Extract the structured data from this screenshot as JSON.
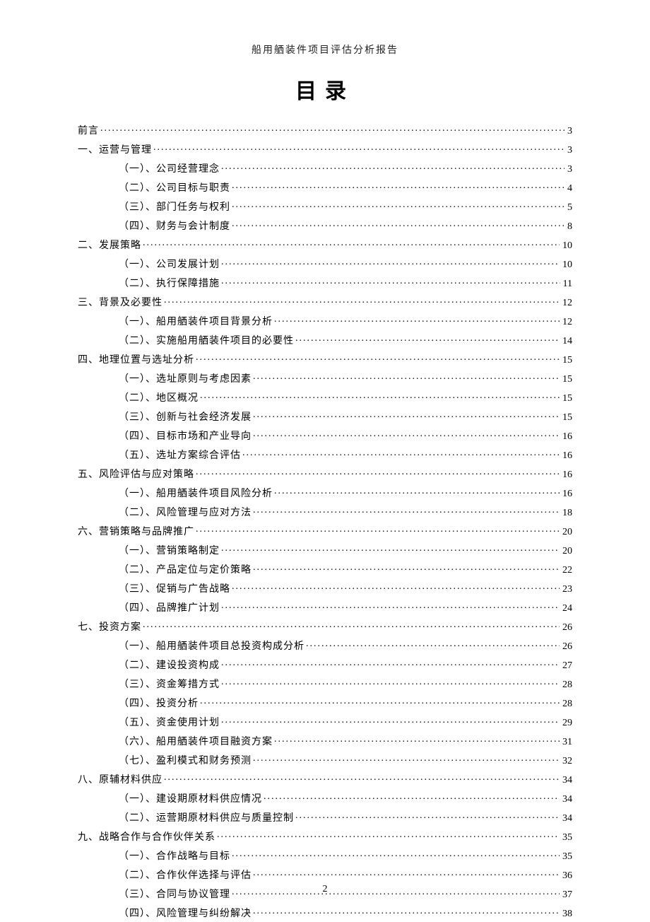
{
  "header": "船用舾装件项目评估分析报告",
  "title": "目录",
  "page_number": "2",
  "toc": [
    {
      "level": 0,
      "label": "前言",
      "page": "3"
    },
    {
      "level": 0,
      "label": "一、运营与管理",
      "page": "3"
    },
    {
      "level": 1,
      "label": "（一）、公司经营理念",
      "page": "3"
    },
    {
      "level": 1,
      "label": "（二）、公司目标与职责",
      "page": "4"
    },
    {
      "level": 1,
      "label": "（三）、部门任务与权利",
      "page": "5"
    },
    {
      "level": 1,
      "label": "（四）、财务与会计制度",
      "page": "8"
    },
    {
      "level": 0,
      "label": "二、发展策略",
      "page": "10"
    },
    {
      "level": 1,
      "label": "（一）、公司发展计划",
      "page": "10"
    },
    {
      "level": 1,
      "label": "（二）、执行保障措施",
      "page": "11"
    },
    {
      "level": 0,
      "label": "三、背景及必要性",
      "page": "12"
    },
    {
      "level": 1,
      "label": "（一）、船用舾装件项目背景分析",
      "page": "12"
    },
    {
      "level": 1,
      "label": "（二）、实施船用舾装件项目的必要性",
      "page": "14"
    },
    {
      "level": 0,
      "label": "四、地理位置与选址分析",
      "page": "15"
    },
    {
      "level": 1,
      "label": "（一）、选址原则与考虑因素",
      "page": "15"
    },
    {
      "level": 1,
      "label": "（二）、地区概况",
      "page": "15"
    },
    {
      "level": 1,
      "label": "（三）、创新与社会经济发展",
      "page": "15"
    },
    {
      "level": 1,
      "label": "（四）、目标市场和产业导向",
      "page": "16"
    },
    {
      "level": 1,
      "label": "（五）、选址方案综合评估",
      "page": "16"
    },
    {
      "level": 0,
      "label": "五、风险评估与应对策略",
      "page": "16"
    },
    {
      "level": 1,
      "label": "（一）、船用舾装件项目风险分析",
      "page": "16"
    },
    {
      "level": 1,
      "label": "（二）、风险管理与应对方法",
      "page": "18"
    },
    {
      "level": 0,
      "label": "六、营销策略与品牌推广",
      "page": "20"
    },
    {
      "level": 1,
      "label": "（一）、营销策略制定",
      "page": "20"
    },
    {
      "level": 1,
      "label": "（二）、产品定位与定价策略",
      "page": "22"
    },
    {
      "level": 1,
      "label": "（三）、促销与广告战略",
      "page": "23"
    },
    {
      "level": 1,
      "label": "（四）、品牌推广计划",
      "page": "24"
    },
    {
      "level": 0,
      "label": "七、投资方案",
      "page": "26"
    },
    {
      "level": 1,
      "label": "（一）、船用舾装件项目总投资构成分析",
      "page": "26"
    },
    {
      "level": 1,
      "label": "（二）、建设投资构成",
      "page": "27"
    },
    {
      "level": 1,
      "label": "（三）、资金筹措方式",
      "page": "28"
    },
    {
      "level": 1,
      "label": "（四）、投资分析",
      "page": "28"
    },
    {
      "level": 1,
      "label": "（五）、资金使用计划",
      "page": "29"
    },
    {
      "level": 1,
      "label": "（六）、船用舾装件项目融资方案",
      "page": "31"
    },
    {
      "level": 1,
      "label": "（七）、盈利模式和财务预测",
      "page": "32"
    },
    {
      "level": 0,
      "label": "八、原辅材料供应",
      "page": "34"
    },
    {
      "level": 1,
      "label": "（一）、建设期原材料供应情况",
      "page": "34"
    },
    {
      "level": 1,
      "label": "（二）、运营期原材料供应与质量控制",
      "page": "34"
    },
    {
      "level": 0,
      "label": "九、战略合作与合作伙伴关系",
      "page": "35"
    },
    {
      "level": 1,
      "label": "（一）、合作战略与目标",
      "page": "35"
    },
    {
      "level": 1,
      "label": "（二）、合作伙伴选择与评估",
      "page": "36"
    },
    {
      "level": 1,
      "label": "（三）、合同与协议管理",
      "page": "37"
    },
    {
      "level": 1,
      "label": "（四）、风险管理与纠纷解决",
      "page": "38"
    }
  ]
}
